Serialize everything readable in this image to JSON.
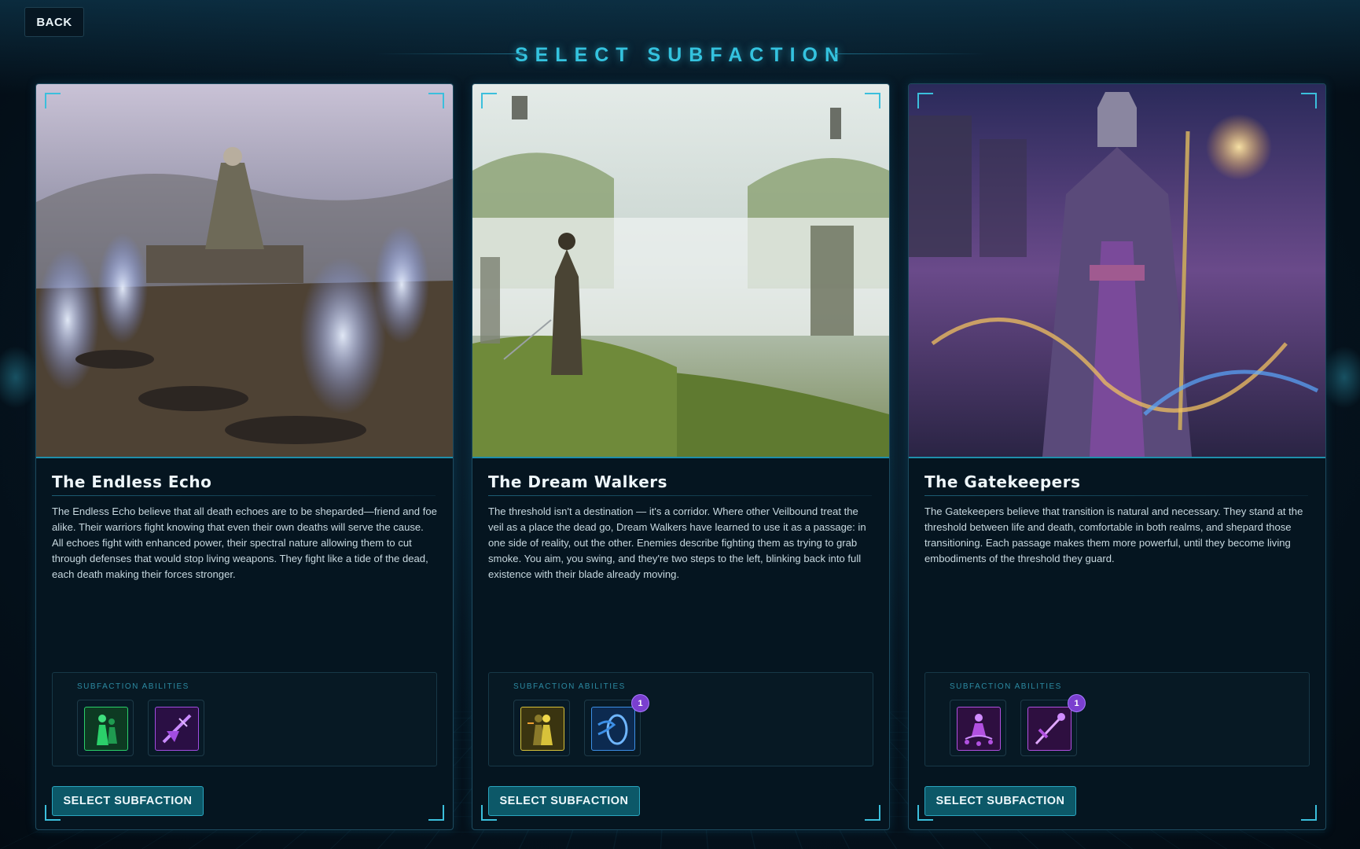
{
  "nav": {
    "back_label": "BACK"
  },
  "page": {
    "title": "SELECT SUBFACTION"
  },
  "colors": {
    "accent": "#34c3df",
    "button": "#0c5868",
    "badge": "#7a3fcf"
  },
  "cards": [
    {
      "name": "The Endless Echo",
      "description": "The Endless Echo believe that all death echoes are to be sheparded—friend and foe alike. Their warriors fight knowing that even their own deaths will serve the cause. All echoes fight with enhanced power, their spectral nature allowing them to cut through defenses that would stop living weapons. They fight like a tide of the dead, each death making their forces stronger.",
      "abilities_label": "SUBFACTION ABILITIES",
      "abilities": [
        {
          "icon": "green-ghost-figures-icon",
          "color": "#2bd06a",
          "badge": null
        },
        {
          "icon": "purple-spectral-blade-icon",
          "color": "#a24de0",
          "badge": null
        }
      ],
      "select_label": "SELECT SUBFACTION"
    },
    {
      "name": "The Dream Walkers",
      "description": "The threshold isn't a destination — it's a corridor. Where other Veilbound treat the veil as a place the dead go, Dream Walkers have learned to use it as a passage: in one side of reality, out the other. Enemies describe fighting them as trying to grab smoke. You aim, you swing, and they're two steps to the left, blinking back into full existence with their blade already moving.",
      "abilities_label": "SUBFACTION ABILITIES",
      "abilities": [
        {
          "icon": "yellow-shadow-step-icon",
          "color": "#d8c23a",
          "badge": null
        },
        {
          "icon": "blue-portal-icon",
          "color": "#3c8fe6",
          "badge": "1"
        }
      ],
      "select_label": "SELECT SUBFACTION"
    },
    {
      "name": "The Gatekeepers",
      "description": "The Gatekeepers believe that transition is natural and necessary. They stand at the threshold between life and death, comfortable in both realms, and shepard those transitioning. Each passage makes them more powerful, until they become living embodiments of the threshold they guard.",
      "abilities_label": "SUBFACTION ABILITIES",
      "abilities": [
        {
          "icon": "purple-meditating-figure-icon",
          "color": "#b150e0",
          "badge": null
        },
        {
          "icon": "purple-staff-strike-icon",
          "color": "#b150e0",
          "badge": "1"
        }
      ],
      "select_label": "SELECT SUBFACTION"
    }
  ]
}
